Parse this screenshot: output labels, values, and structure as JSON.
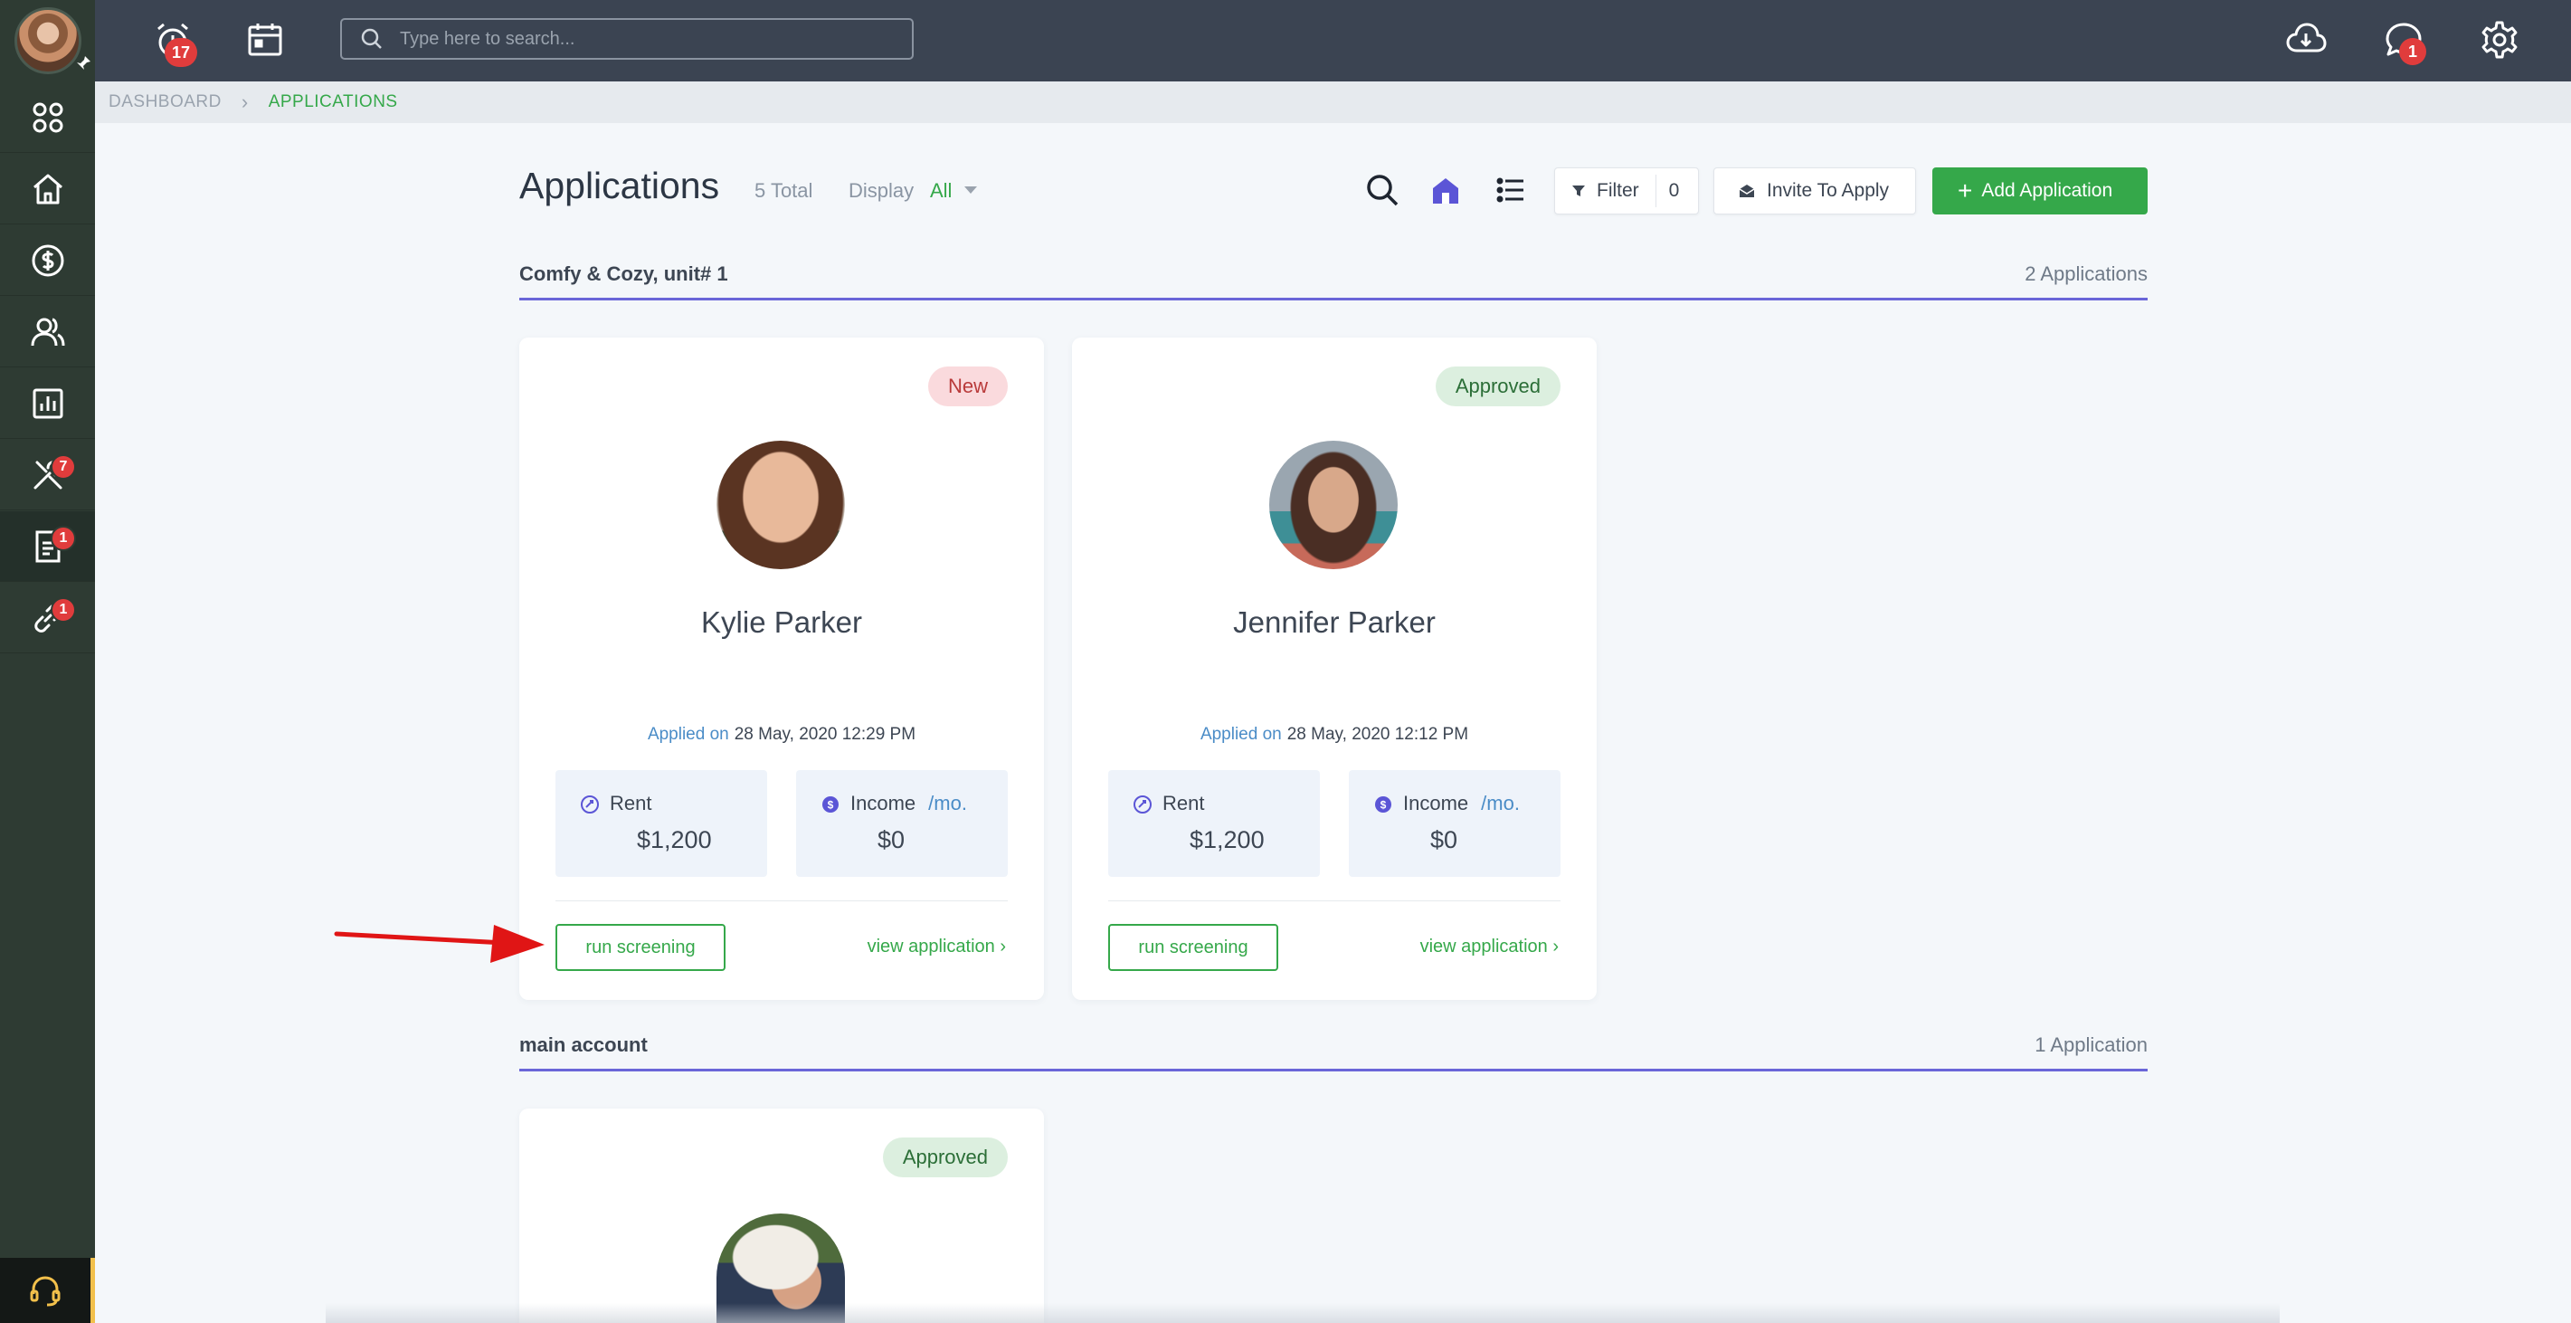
{
  "sidebar": {
    "items": [
      {
        "icon": "dashboard-grid-icon",
        "badge": ""
      },
      {
        "icon": "home-icon",
        "badge": ""
      },
      {
        "icon": "dollar-icon",
        "badge": ""
      },
      {
        "icon": "people-icon",
        "badge": ""
      },
      {
        "icon": "chart-icon",
        "badge": ""
      },
      {
        "icon": "tools-icon",
        "badge": "7"
      },
      {
        "icon": "document-icon",
        "badge": "1"
      },
      {
        "icon": "link-icon",
        "badge": "1"
      }
    ],
    "support_icon": "headset-icon"
  },
  "topbar": {
    "alarm_badge": "17",
    "messages_badge": "1",
    "search_placeholder": "Type here to search..."
  },
  "breadcrumb": {
    "home": "DASHBOARD",
    "current": "APPLICATIONS"
  },
  "header": {
    "title": "Applications",
    "total": "5 Total",
    "display_label": "Display",
    "display_value": "All",
    "filter_label": "Filter",
    "filter_count": "0",
    "invite_label": "Invite To Apply",
    "add_label": "Add Application"
  },
  "groups": [
    {
      "title": "Comfy & Cozy, unit# 1",
      "count": "2 Applications",
      "cards": [
        {
          "status": "New",
          "name": "Kylie Parker",
          "applied_label": "Applied on",
          "applied_date": "28 May, 2020 12:29 PM",
          "rent_label": "Rent",
          "rent_value": "$1,200",
          "income_label": "Income",
          "income_period": "/mo.",
          "income_value": "$0",
          "run_label": "run screening",
          "view_label": "view application ›"
        },
        {
          "status": "Approved",
          "name": "Jennifer Parker",
          "applied_label": "Applied on",
          "applied_date": "28 May, 2020 12:12 PM",
          "rent_label": "Rent",
          "rent_value": "$1,200",
          "income_label": "Income",
          "income_period": "/mo.",
          "income_value": "$0",
          "run_label": "run screening",
          "view_label": "view application ›"
        }
      ]
    },
    {
      "title": "main account",
      "count": "1 Application",
      "cards": [
        {
          "status": "Approved"
        }
      ]
    }
  ],
  "colors": {
    "accent_green": "#35a84a",
    "accent_purple": "#6a66d8",
    "sidebar_bg": "#2e3b33",
    "topbar_bg": "#3b4452",
    "badge_red": "#e03c3c"
  }
}
